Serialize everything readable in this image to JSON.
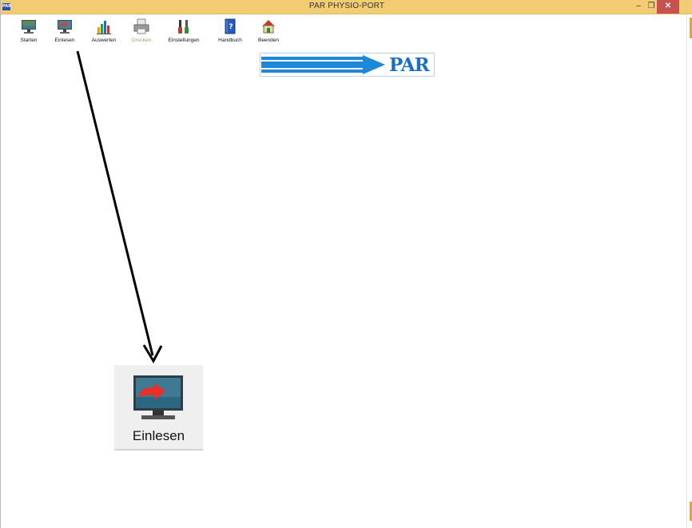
{
  "window": {
    "app_icon_text": "PAR",
    "title": "PAR  PHYSIO-PORT",
    "minimize": "–",
    "restore": "❐",
    "close": "✕"
  },
  "toolbar": {
    "items": [
      {
        "label": "Starten",
        "icon": "monitor-start-icon",
        "enabled": true
      },
      {
        "label": "Einlesen",
        "icon": "monitor-import-icon",
        "enabled": true
      },
      {
        "label": "Auswerten",
        "icon": "chart-evaluate-icon",
        "enabled": true
      },
      {
        "label": "Drucken",
        "icon": "printer-icon",
        "enabled": false
      },
      {
        "label": "Einstellungen",
        "icon": "tools-settings-icon",
        "enabled": true
      },
      {
        "label": "Handbuch",
        "icon": "manual-book-icon",
        "enabled": true
      },
      {
        "label": "Beenden",
        "icon": "house-exit-icon",
        "enabled": true
      }
    ]
  },
  "logo": {
    "text": "PAR",
    "color": "#1a6fc4"
  },
  "callout": {
    "label": "Einlesen",
    "icon": "monitor-import-icon"
  }
}
